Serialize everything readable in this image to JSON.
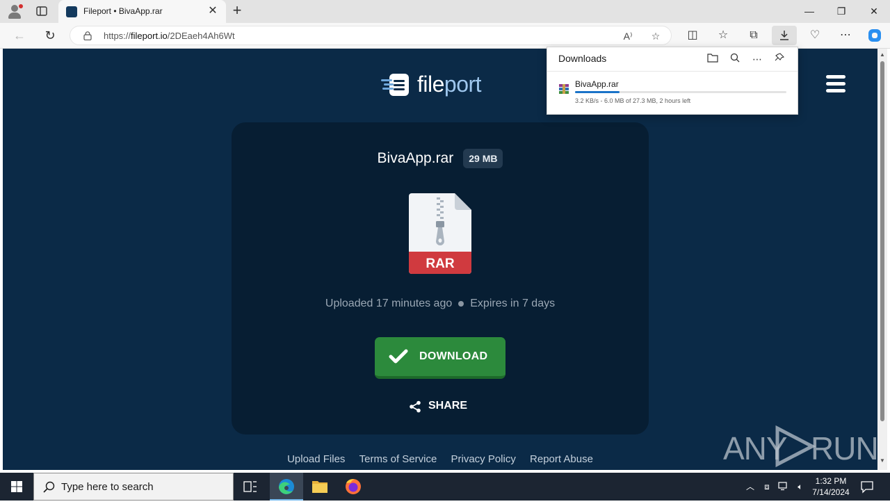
{
  "browser": {
    "tab_title": "Fileport • BivaApp.rar",
    "url_prefix": "https://",
    "url_domain": "fileport.io",
    "url_path": "/2DEaeh4Ah6Wt"
  },
  "page": {
    "brand_part1": "file",
    "brand_part2": "port",
    "file_name": "BivaApp.rar",
    "file_size": "29 MB",
    "file_icon_label": "RAR",
    "uploaded": "Uploaded 17 minutes ago",
    "expires": "Expires in 7 days",
    "download_label": "DOWNLOAD",
    "share_label": "SHARE",
    "footer_links": [
      "Upload Files",
      "Terms of Service",
      "Privacy Policy",
      "Report Abuse"
    ],
    "watermark_left": "ANY",
    "watermark_right": "RUN"
  },
  "downloads": {
    "title": "Downloads",
    "item_name": "BivaApp.rar",
    "item_status": "3.2 KB/s - 6.0 MB of 27.3 MB, 2 hours left",
    "progress_fraction": 0.21
  },
  "taskbar": {
    "search_placeholder": "Type here to search",
    "time": "1:32 PM",
    "date": "7/14/2024"
  },
  "colors": {
    "page_bg": "#0b2a47",
    "card_bg": "#071e33",
    "download_green": "#2c8a3c",
    "rar_red": "#d03a3f",
    "progress_blue": "#1a73c8"
  }
}
